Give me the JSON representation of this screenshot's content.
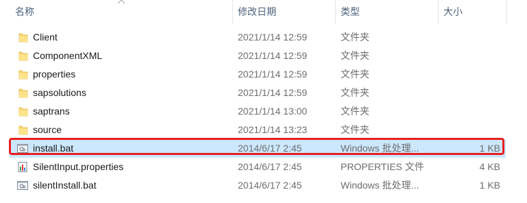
{
  "columns": {
    "name": "名称",
    "date": "修改日期",
    "type": "类型",
    "size": "大小"
  },
  "files": [
    {
      "name": "Client",
      "date": "2021/1/14 12:59",
      "type": "文件夹",
      "size": "",
      "icon": "folder-icon"
    },
    {
      "name": "ComponentXML",
      "date": "2021/1/14 12:59",
      "type": "文件夹",
      "size": "",
      "icon": "folder-icon"
    },
    {
      "name": "properties",
      "date": "2021/1/14 12:59",
      "type": "文件夹",
      "size": "",
      "icon": "folder-icon"
    },
    {
      "name": "sapsolutions",
      "date": "2021/1/14 12:59",
      "type": "文件夹",
      "size": "",
      "icon": "folder-icon"
    },
    {
      "name": "saptrans",
      "date": "2021/1/14 13:00",
      "type": "文件夹",
      "size": "",
      "icon": "folder-icon"
    },
    {
      "name": "source",
      "date": "2021/1/14 13:23",
      "type": "文件夹",
      "size": "",
      "icon": "folder-icon"
    },
    {
      "name": "install.bat",
      "date": "2014/6/17 2:45",
      "type": "Windows 批处理...",
      "size": "1 KB",
      "icon": "batch-file-icon",
      "selected": true
    },
    {
      "name": "SilentInput.properties",
      "date": "2014/6/17 2:45",
      "type": "PROPERTIES 文件",
      "size": "4 KB",
      "icon": "properties-file-icon"
    },
    {
      "name": "silentInstall.bat",
      "date": "2014/6/17 2:45",
      "type": "Windows 批处理...",
      "size": "1 KB",
      "icon": "batch-file-icon"
    }
  ],
  "colors": {
    "selection": "#cce8ff",
    "highlight_border": "#e81f1f",
    "folder": "#f8d775",
    "header_text": "#4c607a"
  }
}
